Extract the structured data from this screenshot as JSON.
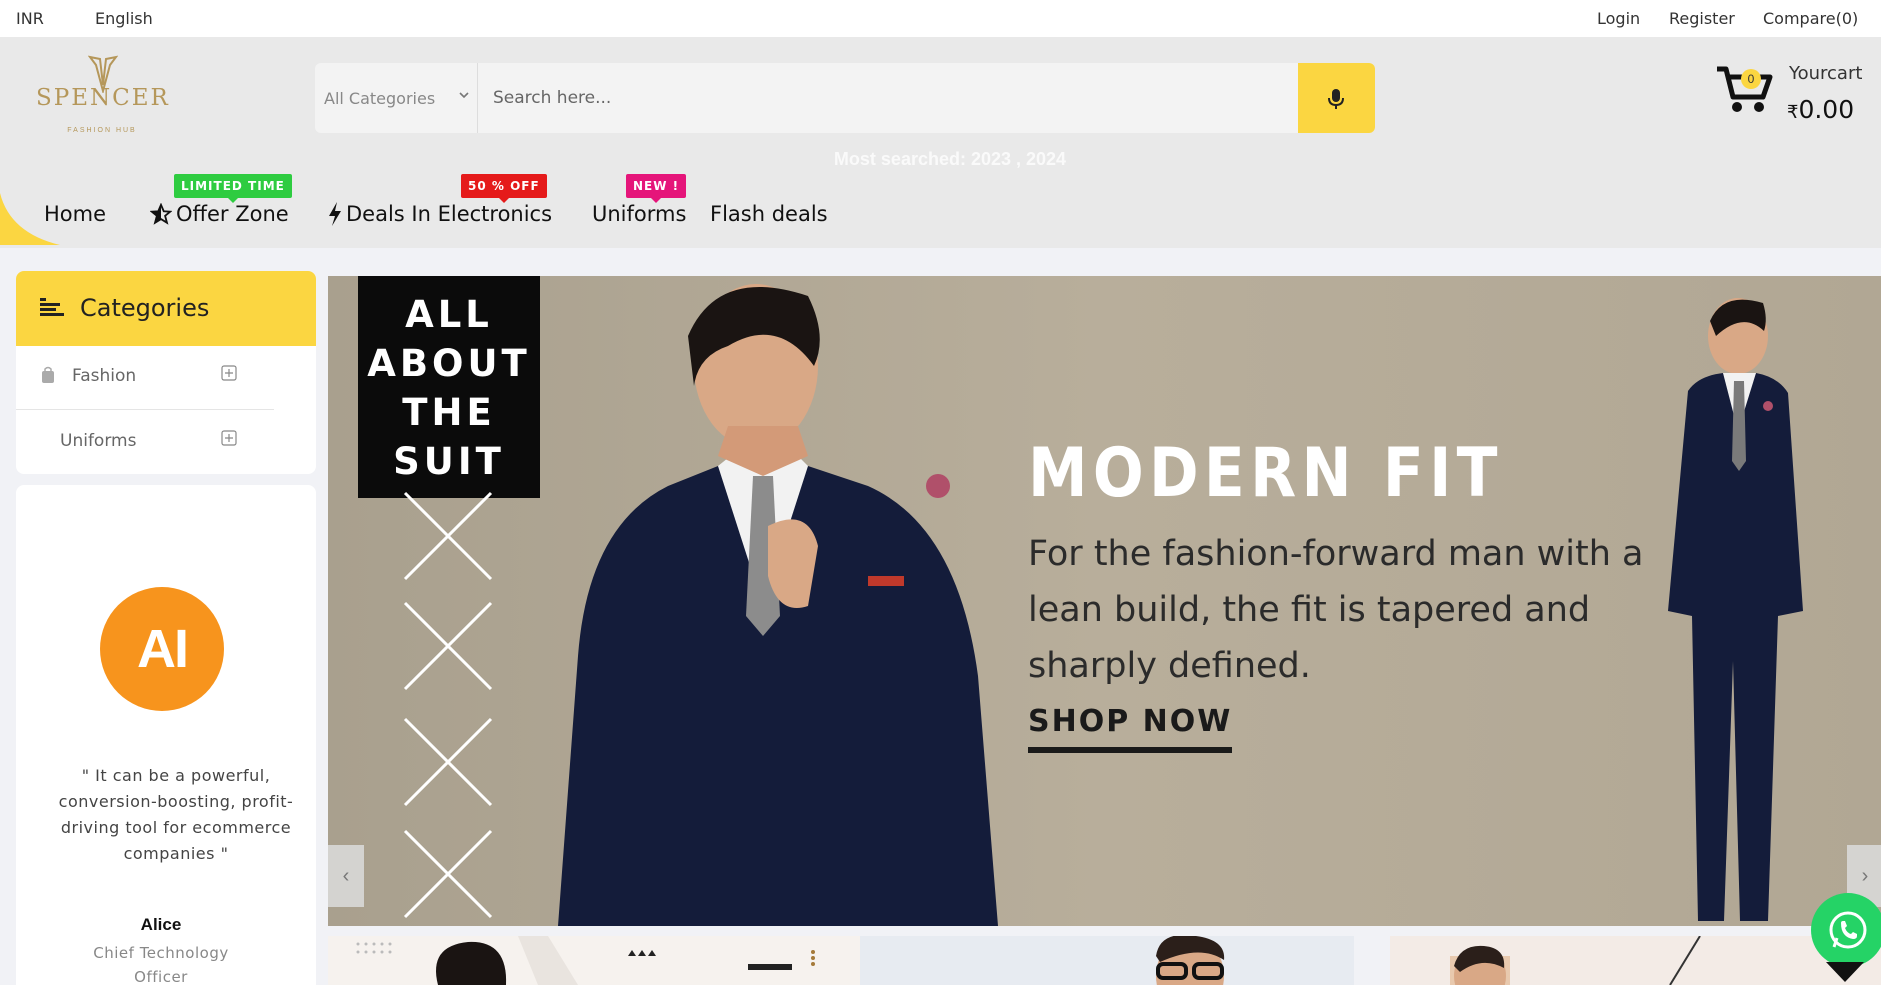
{
  "topbar": {
    "currency": "INR",
    "language": "English",
    "login": "Login",
    "register": "Register",
    "compare": "Compare(0)"
  },
  "brand": {
    "name": "SPENCER",
    "tagline": "FASHION HUB",
    "color": "#b5975a"
  },
  "search": {
    "category": "All Categories",
    "placeholder": "Search here...",
    "most_searched": "Most searched: 2023 , 2024"
  },
  "cart": {
    "count": "0",
    "label": "Yourcart",
    "currency_symbol": "₹",
    "total": "0.00"
  },
  "nav": {
    "items": [
      {
        "label": "Home"
      },
      {
        "label": "Offer Zone",
        "tag": "LIMITED TIME",
        "tag_color": "#2ecc40",
        "icon": "star-icon"
      },
      {
        "label": "Deals In Electronics",
        "tag": "50 % OFF",
        "tag_color": "#e51a1a",
        "icon": "bolt-icon"
      },
      {
        "label": "Uniforms",
        "tag": "NEW !",
        "tag_color": "#e5157a"
      },
      {
        "label": "Flash deals"
      }
    ]
  },
  "sidebar": {
    "title": "Categories",
    "items": [
      {
        "label": "Fashion"
      },
      {
        "label": "Uniforms"
      }
    ]
  },
  "testimonial": {
    "avatar_text": "AI",
    "quote": "\" It can be a powerful, conversion-boosting, profit-driving tool for ecommerce companies \"",
    "name": "Alice",
    "role": "Chief Technology Officer"
  },
  "banner": {
    "side_text": "ALL ABOUT THE SUIT",
    "headline": "MODERN FIT",
    "body": "For the fashion-forward man with a lean build, the fit is tapered and sharply defined.",
    "cta": "SHOP NOW"
  },
  "colors": {
    "accent": "#fbd641",
    "avatar": "#f7941d",
    "whatsapp": "#25d366"
  }
}
